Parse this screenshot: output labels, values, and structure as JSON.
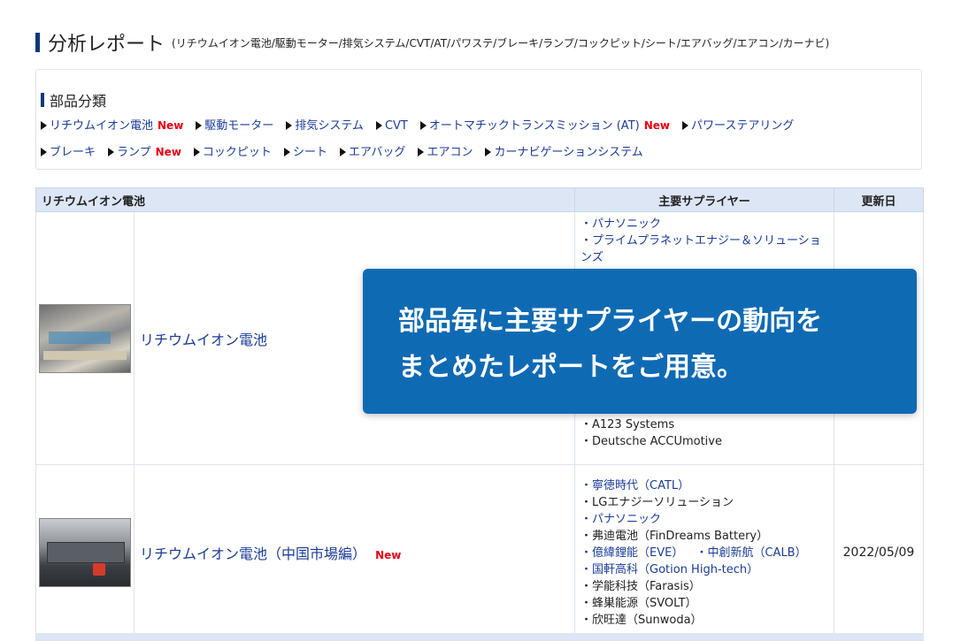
{
  "header": {
    "title": "分析レポート",
    "subtitle": "(リチウムイオン電池/駆動モーター/排気システム/CVT/AT/パワステ/ブレーキ/ランプ/コックピット/シート/エアバッグ/エアコン/カーナビ)"
  },
  "categories": {
    "heading": "部品分類",
    "new_label": "New",
    "row1": [
      {
        "label": "リチウムイオン電池",
        "new": true
      },
      {
        "label": "駆動モーター",
        "new": false
      },
      {
        "label": "排気システム",
        "new": false
      },
      {
        "label": "CVT",
        "new": false
      },
      {
        "label": "オートマチックトランスミッション (AT)",
        "new": true
      },
      {
        "label": "パワーステアリング",
        "new": false
      }
    ],
    "row2": [
      {
        "label": "ブレーキ",
        "new": false
      },
      {
        "label": "ランプ",
        "new": true
      },
      {
        "label": "コックピット",
        "new": false
      },
      {
        "label": "シート",
        "new": false
      },
      {
        "label": "エアバッグ",
        "new": false
      },
      {
        "label": "エアコン",
        "new": false
      },
      {
        "label": "カーナビゲーションシステム",
        "new": false
      }
    ]
  },
  "table": {
    "headers": {
      "part": "リチウムイオン電池",
      "suppliers": "主要サプライヤー",
      "updated": "更新日"
    },
    "row1": {
      "name": "リチウムイオン電池",
      "suppliers_top": [
        "・パナソニック",
        "・プライムプラネットエナジー＆ソリューションズ"
      ],
      "suppliers_bottom": [
        "・A123 Systems",
        "・Deutsche ACCUmotive"
      ],
      "date": ""
    },
    "row2": {
      "name": "リチウムイオン電池（中国市場編）",
      "new_label": "New",
      "suppliers": {
        "s1": "・寧徳時代（CATL）",
        "s2": "・LGエナジーソリューション",
        "s3": "・パナソニック",
        "s4": "・弗迪電池（FinDreams Battery）",
        "s5a": "・億緯鋰能（EVE）",
        "s5b": "・中創新航（CALB）",
        "s6": "・国軒高科（Gotion High-tech）",
        "s7": "・学能科技（Farasis）",
        "s8": "・蜂巣能源（SVOLT）",
        "s9": "・欣旺達（Sunwoda）"
      },
      "date": "2022/05/09"
    }
  },
  "overlay": {
    "line1": "部品毎に主要サプライヤーの動向を",
    "line2": "まとめたレポートをご用意。"
  }
}
